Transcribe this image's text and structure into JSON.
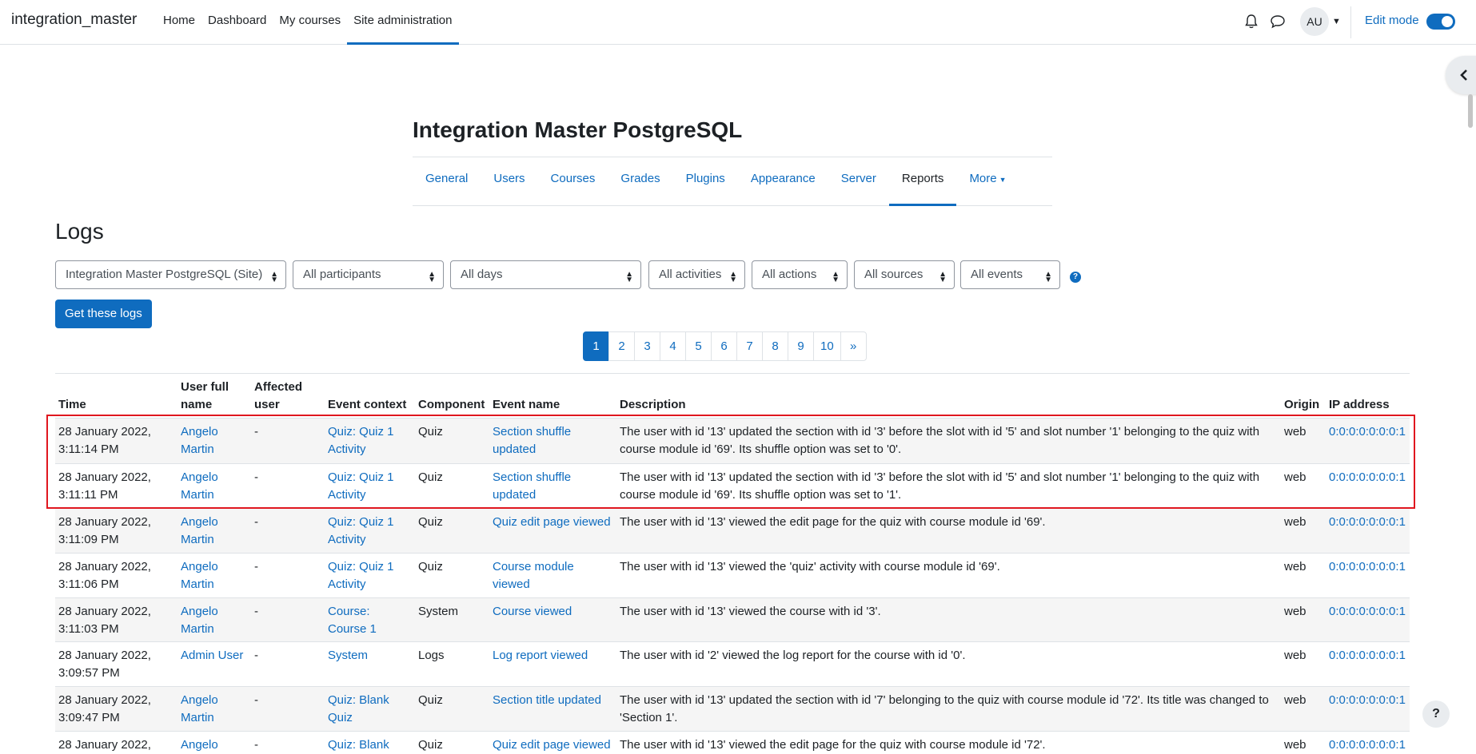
{
  "navbar": {
    "brand": "integration_master",
    "items": [
      {
        "label": "Home"
      },
      {
        "label": "Dashboard"
      },
      {
        "label": "My courses"
      },
      {
        "label": "Site administration"
      }
    ],
    "avatar_initials": "AU",
    "edit_mode_label": "Edit mode",
    "edit_mode_on": true
  },
  "site_title": "Integration Master PostgreSQL",
  "secondary_nav": [
    {
      "label": "General"
    },
    {
      "label": "Users"
    },
    {
      "label": "Courses"
    },
    {
      "label": "Grades"
    },
    {
      "label": "Plugins"
    },
    {
      "label": "Appearance"
    },
    {
      "label": "Server"
    },
    {
      "label": "Reports"
    },
    {
      "label": "More"
    }
  ],
  "page_heading": "Logs",
  "filters": [
    {
      "value": "Integration Master PostgreSQL (Site)"
    },
    {
      "value": "All participants"
    },
    {
      "value": "All days"
    },
    {
      "value": "All activities"
    },
    {
      "value": "All actions"
    },
    {
      "value": "All sources"
    },
    {
      "value": "All events"
    }
  ],
  "get_logs_button": "Get these logs",
  "pagination": [
    "1",
    "2",
    "3",
    "4",
    "5",
    "6",
    "7",
    "8",
    "9",
    "10",
    "»"
  ],
  "table": {
    "headers": {
      "time": "Time",
      "user_full_name_1": "User full",
      "user_full_name_2": "name",
      "affected_user_1": "Affected",
      "affected_user_2": "user",
      "event_context": "Event context",
      "component": "Component",
      "event_name": "Event name",
      "description": "Description",
      "origin": "Origin",
      "ip_address": "IP address"
    },
    "rows": [
      {
        "time1": "28 January 2022,",
        "time2": "3:11:14 PM",
        "user1": "Angelo",
        "user2": "Martin",
        "affected": "-",
        "ctx1": "Quiz: Quiz 1",
        "ctx2": "Activity",
        "component": "Quiz",
        "event1": "Section shuffle",
        "event2": "updated",
        "desc1": "The user with id '13' updated the section with id '3' before the slot with id '5' and slot number '1' belonging to the quiz with",
        "desc2": "course module id '69'. Its shuffle option was set to '0'.",
        "origin": "web",
        "ip": "0:0:0:0:0:0:0:1"
      },
      {
        "time1": "28 January 2022,",
        "time2": "3:11:11 PM",
        "user1": "Angelo",
        "user2": "Martin",
        "affected": "-",
        "ctx1": "Quiz: Quiz 1",
        "ctx2": "Activity",
        "component": "Quiz",
        "event1": "Section shuffle",
        "event2": "updated",
        "desc1": "The user with id '13' updated the section with id '3' before the slot with id '5' and slot number '1' belonging to the quiz with",
        "desc2": "course module id '69'. Its shuffle option was set to '1'.",
        "origin": "web",
        "ip": "0:0:0:0:0:0:0:1"
      },
      {
        "time1": "28 January 2022,",
        "time2": "3:11:09 PM",
        "user1": "Angelo",
        "user2": "Martin",
        "affected": "-",
        "ctx1": "Quiz: Quiz 1",
        "ctx2": "Activity",
        "component": "Quiz",
        "event1": "Quiz edit page viewed",
        "event2": "",
        "desc1": "The user with id '13' viewed the edit page for the quiz with course module id '69'.",
        "desc2": "",
        "origin": "web",
        "ip": "0:0:0:0:0:0:0:1"
      },
      {
        "time1": "28 January 2022,",
        "time2": "3:11:06 PM",
        "user1": "Angelo",
        "user2": "Martin",
        "affected": "-",
        "ctx1": "Quiz: Quiz 1",
        "ctx2": "Activity",
        "component": "Quiz",
        "event1": "Course module",
        "event2": "viewed",
        "desc1": "The user with id '13' viewed the 'quiz' activity with course module id '69'.",
        "desc2": "",
        "origin": "web",
        "ip": "0:0:0:0:0:0:0:1"
      },
      {
        "time1": "28 January 2022,",
        "time2": "3:11:03 PM",
        "user1": "Angelo",
        "user2": "Martin",
        "affected": "-",
        "ctx1": "Course:",
        "ctx2": "Course 1",
        "component": "System",
        "event1": "Course viewed",
        "event2": "",
        "desc1": "The user with id '13' viewed the course with id '3'.",
        "desc2": "",
        "origin": "web",
        "ip": "0:0:0:0:0:0:0:1"
      },
      {
        "time1": "28 January 2022,",
        "time2": "3:09:57 PM",
        "user1": "Admin User",
        "user2": "",
        "affected": "-",
        "ctx1": "System",
        "ctx2": "",
        "component": "Logs",
        "event1": "Log report viewed",
        "event2": "",
        "desc1": "The user with id '2' viewed the log report for the course with id '0'.",
        "desc2": "",
        "origin": "web",
        "ip": "0:0:0:0:0:0:0:1"
      },
      {
        "time1": "28 January 2022,",
        "time2": "3:09:47 PM",
        "user1": "Angelo",
        "user2": "Martin",
        "affected": "-",
        "ctx1": "Quiz: Blank",
        "ctx2": "Quiz",
        "component": "Quiz",
        "event1": "Section title updated",
        "event2": "",
        "desc1": "The user with id '13' updated the section with id '7' belonging to the quiz with course module id '72'. Its title was changed to",
        "desc2": "'Section 1'.",
        "origin": "web",
        "ip": "0:0:0:0:0:0:0:1"
      },
      {
        "time1": "28 January 2022,",
        "time2": "",
        "user1": "Angelo",
        "user2": "",
        "affected": "-",
        "ctx1": "Quiz: Blank",
        "ctx2": "",
        "component": "Quiz",
        "event1": "Quiz edit page viewed",
        "event2": "",
        "desc1": "The user with id '13' viewed the edit page for the quiz with course module id '72'.",
        "desc2": "",
        "origin": "web",
        "ip": "0:0:0:0:0:0:0:1"
      }
    ]
  },
  "help_button": "?"
}
